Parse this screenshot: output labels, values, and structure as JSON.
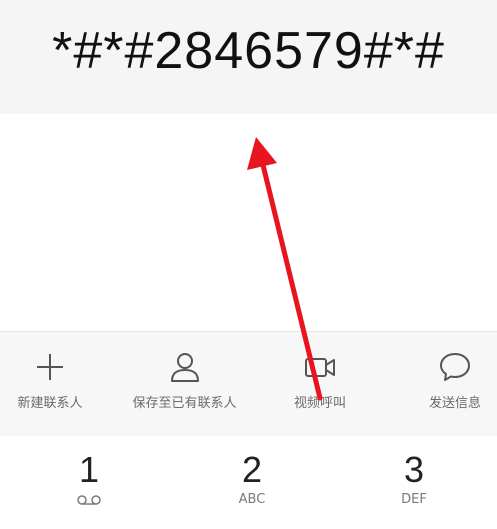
{
  "dialer": {
    "number": "*#*#2846579#*#"
  },
  "actions": [
    {
      "label": "新建联系人",
      "icon": "plus-icon"
    },
    {
      "label": "保存至已有联系人",
      "icon": "person-icon"
    },
    {
      "label": "视频呼叫",
      "icon": "video-camera-icon"
    },
    {
      "label": "发送信息",
      "icon": "message-bubble-icon"
    }
  ],
  "keypad": [
    {
      "digit": "1",
      "sub": "",
      "icon": "voicemail-icon"
    },
    {
      "digit": "2",
      "sub": "ABC"
    },
    {
      "digit": "3",
      "sub": "DEF"
    }
  ],
  "colors": {
    "annotation_arrow": "#e8141e",
    "display_bg": "#f5f5f5",
    "action_bar_bg": "#f7f7f7"
  }
}
